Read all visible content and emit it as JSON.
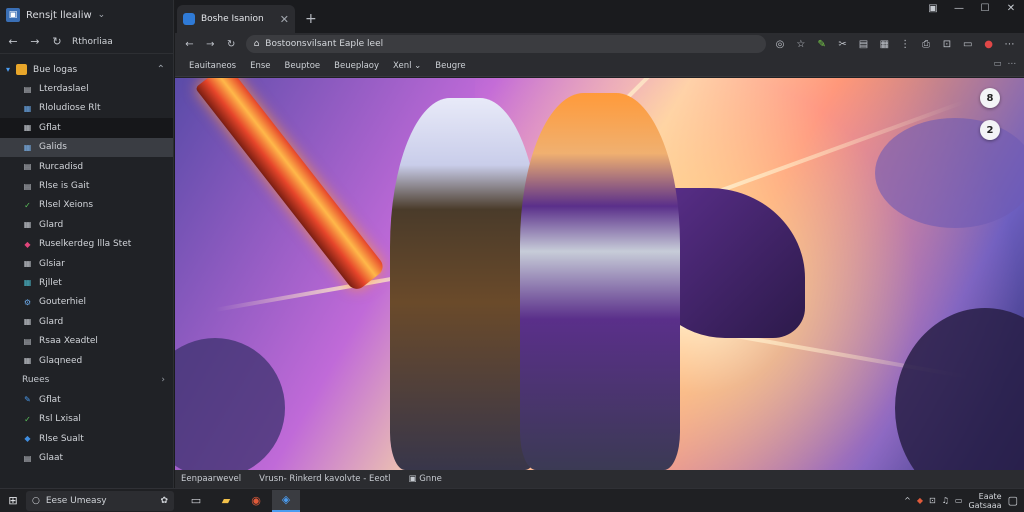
{
  "sidebar": {
    "app_title": "Rensjt llealiw",
    "path": "Rthorliaa",
    "root_label": "Bue logas",
    "items": [
      {
        "label": "Lterdaslael",
        "icon": "file-icon",
        "color": "#c7cbd1"
      },
      {
        "label": "Rloludiose Rlt",
        "icon": "grid-icon",
        "color": "#6aa8e8"
      },
      {
        "label": "Gflat",
        "icon": "grid-icon",
        "color": "#c7cbd1"
      },
      {
        "label": "Galids",
        "icon": "grid-icon",
        "color": "#7ab0e8"
      },
      {
        "label": "Rurcadisd",
        "icon": "file-icon",
        "color": "#c7cbd1"
      },
      {
        "label": "Rlse is Gait",
        "icon": "file-icon",
        "color": "#c7cbd1"
      },
      {
        "label": "Rlsel Xeions",
        "icon": "check-icon",
        "color": "#5cc45c"
      },
      {
        "label": "Glard",
        "icon": "grid-icon",
        "color": "#c7cbd1"
      },
      {
        "label": "Ruselkerdeg llla Stet",
        "icon": "app-icon",
        "color": "#e0457a"
      },
      {
        "label": "Glsiar",
        "icon": "grid-icon",
        "color": "#c7cbd1"
      },
      {
        "label": "Rjllet",
        "icon": "grid-icon",
        "color": "#4ab7c8"
      },
      {
        "label": "Gouterhiel",
        "icon": "gear-icon",
        "color": "#6aa8e8"
      },
      {
        "label": "Glard",
        "icon": "grid-icon",
        "color": "#c7cbd1"
      },
      {
        "label": "Rsaa Xeadtel",
        "icon": "file-icon",
        "color": "#c7cbd1"
      },
      {
        "label": "Glaqneed",
        "icon": "grid-icon",
        "color": "#c7cbd1"
      }
    ],
    "section_label": "Ruees",
    "section_items": [
      {
        "label": "Gflat",
        "icon": "pen-icon",
        "color": "#4a9cf0"
      },
      {
        "label": "Rsl Lxisal",
        "icon": "check-icon",
        "color": "#5cc45c"
      },
      {
        "label": "Rlse Sualt",
        "icon": "app-icon",
        "color": "#3f8de0"
      },
      {
        "label": "Glaat",
        "icon": "file-icon",
        "color": "#c7cbd1"
      }
    ]
  },
  "browser": {
    "tab_title": "Boshe Isanion",
    "new_tab": "+",
    "url": "Bostoonsvilsant Eaple leel",
    "bookmarks": [
      "Eauitaneos",
      "Ense",
      "Beuptoe",
      "Beueplaoy",
      "Xenl",
      "Beugre"
    ],
    "status_left": "Eenpaarwevel",
    "status_mid": "Vrusn- Rinkerd kavolvte - Eeotl",
    "status_right": "Gnne"
  },
  "viewport": {
    "btn1": "8",
    "btn2": "2"
  },
  "taskbar": {
    "search_text": "Eese Umeasy",
    "time": "Eaate",
    "date": "Gatsaaa"
  }
}
